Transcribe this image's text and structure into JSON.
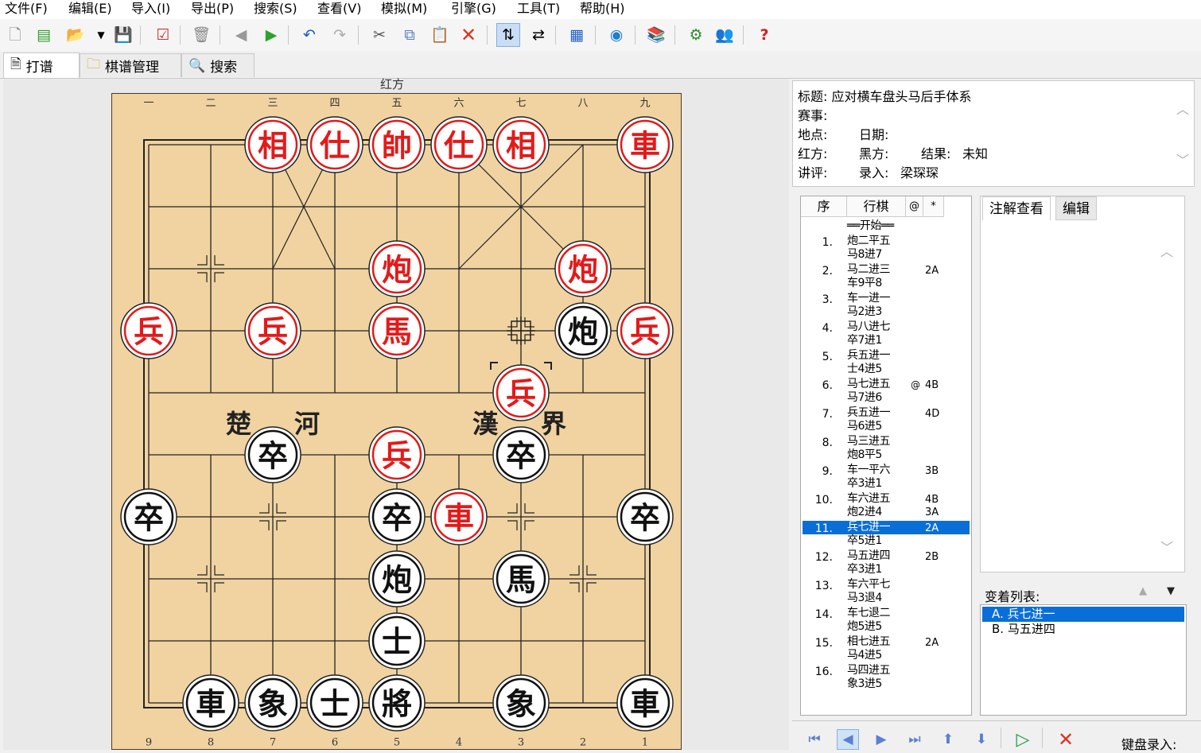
{
  "menu": [
    "文件(F)",
    "编辑(E)",
    "导入(I)",
    "导出(P)",
    "搜索(S)",
    "查看(V)",
    "模拟(M)",
    "引擎(G)",
    "工具(T)",
    "帮助(H)"
  ],
  "tabs": [
    {
      "label": "打谱",
      "icon": "document-icon"
    },
    {
      "label": "棋谱管理",
      "icon": "folder-icon"
    },
    {
      "label": "搜索",
      "icon": "magnifier-icon"
    }
  ],
  "board": {
    "top_side_label": "红方",
    "top_numbers": [
      "一",
      "二",
      "三",
      "四",
      "五",
      "六",
      "七",
      "八",
      "九"
    ],
    "bottom_numbers": [
      "9",
      "8",
      "7",
      "6",
      "5",
      "4",
      "3",
      "2",
      "1"
    ],
    "river_left": [
      "楚",
      "河"
    ],
    "river_right": [
      "漢",
      "界"
    ],
    "colors": {
      "red": "#e31a1a",
      "black": "#111111",
      "board": "#f0d3a1"
    },
    "pieces": [
      {
        "side": "red",
        "char": "相",
        "file": 2,
        "rank": 0
      },
      {
        "side": "red",
        "char": "仕",
        "file": 3,
        "rank": 0
      },
      {
        "side": "red",
        "char": "帥",
        "file": 4,
        "rank": 0
      },
      {
        "side": "red",
        "char": "仕",
        "file": 5,
        "rank": 0
      },
      {
        "side": "red",
        "char": "相",
        "file": 6,
        "rank": 0
      },
      {
        "side": "red",
        "char": "車",
        "file": 8,
        "rank": 0
      },
      {
        "side": "red",
        "char": "炮",
        "file": 4,
        "rank": 2
      },
      {
        "side": "red",
        "char": "炮",
        "file": 7,
        "rank": 2
      },
      {
        "side": "red",
        "char": "兵",
        "file": 0,
        "rank": 3
      },
      {
        "side": "red",
        "char": "兵",
        "file": 2,
        "rank": 3
      },
      {
        "side": "red",
        "char": "馬",
        "file": 4,
        "rank": 3
      },
      {
        "side": "black",
        "char": "炮",
        "file": 7,
        "rank": 3
      },
      {
        "side": "red",
        "char": "兵",
        "file": 8,
        "rank": 3
      },
      {
        "side": "red",
        "char": "兵",
        "file": 6,
        "rank": 4
      },
      {
        "side": "black",
        "char": "卒",
        "file": 2,
        "rank": 5
      },
      {
        "side": "red",
        "char": "兵",
        "file": 4,
        "rank": 5
      },
      {
        "side": "black",
        "char": "卒",
        "file": 6,
        "rank": 5
      },
      {
        "side": "black",
        "char": "卒",
        "file": 0,
        "rank": 6
      },
      {
        "side": "black",
        "char": "卒",
        "file": 4,
        "rank": 6
      },
      {
        "side": "red",
        "char": "車",
        "file": 5,
        "rank": 6
      },
      {
        "side": "black",
        "char": "卒",
        "file": 8,
        "rank": 6
      },
      {
        "side": "black",
        "char": "炮",
        "file": 4,
        "rank": 7
      },
      {
        "side": "black",
        "char": "馬",
        "file": 6,
        "rank": 7
      },
      {
        "side": "black",
        "char": "士",
        "file": 4,
        "rank": 8
      },
      {
        "side": "black",
        "char": "車",
        "file": 1,
        "rank": 9
      },
      {
        "side": "black",
        "char": "象",
        "file": 2,
        "rank": 9
      },
      {
        "side": "black",
        "char": "士",
        "file": 3,
        "rank": 9
      },
      {
        "side": "black",
        "char": "將",
        "file": 4,
        "rank": 9
      },
      {
        "side": "black",
        "char": "象",
        "file": 6,
        "rank": 9
      },
      {
        "side": "black",
        "char": "車",
        "file": 8,
        "rank": 9
      }
    ],
    "last_move_from": {
      "file": 6,
      "rank": 3
    },
    "last_move_to": {
      "file": 6,
      "rank": 4
    }
  },
  "info": {
    "title_label": "标题:",
    "title": "应对横车盘头马后手体系",
    "event_label": "赛事:",
    "place_label": "地点:",
    "date_label": "日期:",
    "red_label": "红方:",
    "black_label": "黑方:",
    "result_label": "结果:",
    "result": "未知",
    "comment_label": "讲评:",
    "recorder_label": "录入:",
    "recorder": "梁琛琛"
  },
  "movelist": {
    "headers": [
      "序",
      "行棋",
      "@",
      "*"
    ],
    "start": "══开始══",
    "moves": [
      {
        "n": "1.",
        "red": "炮二平五",
        "black": "马8进7",
        "k": ""
      },
      {
        "n": "2.",
        "red": "马二进三",
        "black": "车9平8",
        "k": "2A"
      },
      {
        "n": "3.",
        "red": "车一进一",
        "black": "马2进3",
        "k": ""
      },
      {
        "n": "4.",
        "red": "马八进七",
        "black": "卒7进1",
        "k": ""
      },
      {
        "n": "5.",
        "red": "兵五进一",
        "black": "士4进5",
        "k": ""
      },
      {
        "n": "6.",
        "red": "马七进五",
        "black": "马7进6",
        "k": "4B",
        "at": "@"
      },
      {
        "n": "7.",
        "red": "兵五进一",
        "black": "马6进5",
        "k": "4D"
      },
      {
        "n": "8.",
        "red": "马三进五",
        "black": "炮8平5",
        "k": ""
      },
      {
        "n": "9.",
        "red": "车一平六",
        "black": "卒3进1",
        "k": "3B"
      },
      {
        "n": "10.",
        "red": "车六进五",
        "black": "炮2进4",
        "k": "4B",
        "k2": "3A"
      },
      {
        "n": "11.",
        "red": "兵七进一",
        "black": "卒5进1",
        "k": "2A"
      },
      {
        "n": "12.",
        "red": "马五进四",
        "black": "卒3进1",
        "k": "2B"
      },
      {
        "n": "13.",
        "red": "车六平七",
        "black": "马3退4",
        "k": ""
      },
      {
        "n": "14.",
        "red": "车七退二",
        "black": "炮5进5",
        "k": ""
      },
      {
        "n": "15.",
        "red": "相七进五",
        "black": "马4进5",
        "k": "2A"
      },
      {
        "n": "16.",
        "red": "马四进五",
        "black": "象3进5",
        "k": ""
      }
    ]
  },
  "annotation": {
    "tab_view": "注解查看",
    "tab_edit": "编辑"
  },
  "variations": {
    "label": "变着列表:",
    "items": [
      "A. 兵七进一",
      "B. 马五进四"
    ]
  },
  "keyboard_label": "键盘录入:"
}
